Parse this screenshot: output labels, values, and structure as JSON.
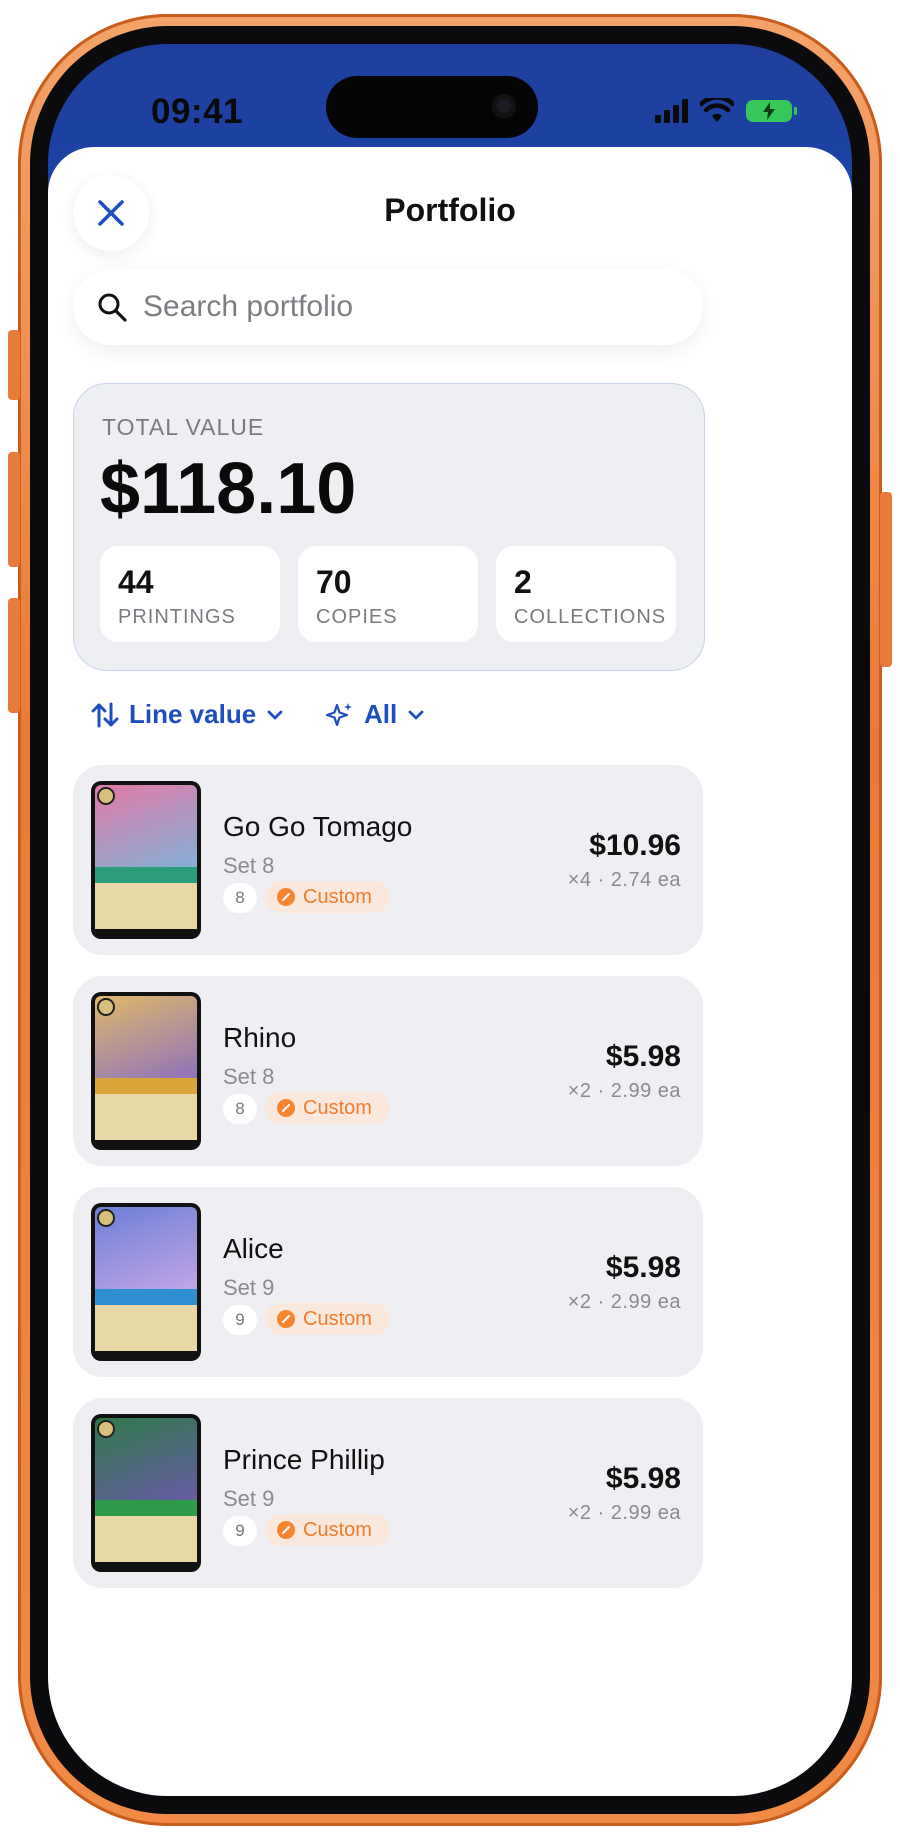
{
  "status_bar": {
    "time": "09:41"
  },
  "header": {
    "title": "Portfolio",
    "close_icon": "close-icon"
  },
  "search": {
    "placeholder": "Search portfolio",
    "value": ""
  },
  "summary": {
    "total_label": "TOTAL VALUE",
    "total_value": "$118.10",
    "stats": [
      {
        "value": "44",
        "label": "PRINTINGS"
      },
      {
        "value": "70",
        "label": "COPIES"
      },
      {
        "value": "2",
        "label": "COLLECTIONS"
      }
    ]
  },
  "filters": {
    "sort_label": "Line value",
    "filter_label": "All"
  },
  "items": [
    {
      "name": "Go Go Tomago",
      "set": "Set 8",
      "set_badge": "8",
      "tag": "Custom",
      "price": "$10.96",
      "qty": "×4 · 2.74 ea",
      "art_colors": [
        "#e27aa6",
        "#7fb3d9"
      ],
      "band_color": "#2a9d7a"
    },
    {
      "name": "Rhino",
      "set": "Set 8",
      "set_badge": "8",
      "tag": "Custom",
      "price": "$5.98",
      "qty": "×2 · 2.99 ea",
      "art_colors": [
        "#e0b86a",
        "#8a6fbf"
      ],
      "band_color": "#d9a53a"
    },
    {
      "name": "Alice",
      "set": "Set 9",
      "set_badge": "9",
      "tag": "Custom",
      "price": "$5.98",
      "qty": "×2 · 2.99 ea",
      "art_colors": [
        "#6b7fd6",
        "#c7a7e8"
      ],
      "band_color": "#2d8fd1"
    },
    {
      "name": "Prince Phillip",
      "set": "Set 9",
      "set_badge": "9",
      "tag": "Custom",
      "price": "$5.98",
      "qty": "×2 · 2.99 ea",
      "art_colors": [
        "#2f7a4a",
        "#6a5aa8"
      ],
      "band_color": "#2f9a4a"
    }
  ],
  "colors": {
    "accent": "#1f4fbf",
    "custom_tag": "#f07c2e",
    "frame": "#e97a35"
  }
}
